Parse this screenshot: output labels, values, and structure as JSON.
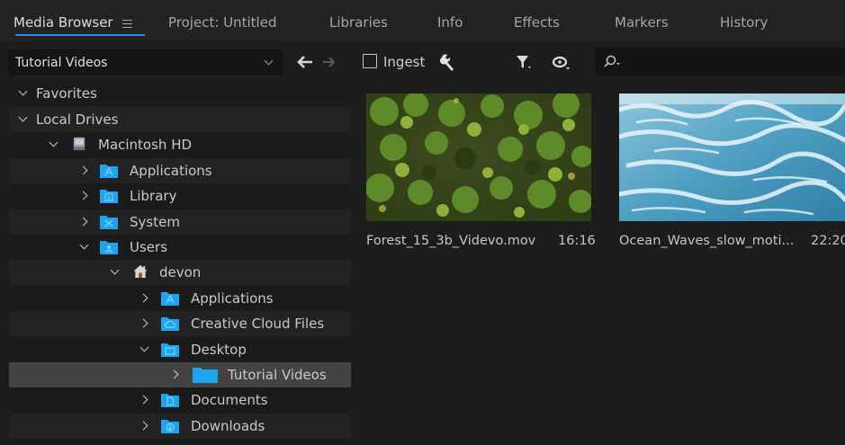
{
  "tabs": [
    {
      "label": "Media Browser",
      "active": true
    },
    {
      "label": "Project: Untitled"
    },
    {
      "label": "Libraries"
    },
    {
      "label": "Info"
    },
    {
      "label": "Effects"
    },
    {
      "label": "Markers"
    },
    {
      "label": "History"
    }
  ],
  "toolbar": {
    "path_value": "Tutorial Videos",
    "ingest_label": "Ingest",
    "ingest_checked": false,
    "search_value": ""
  },
  "tree": [
    {
      "label": "Favorites",
      "expanded": true,
      "icon": "none"
    },
    {
      "label": "Local Drives",
      "expanded": true,
      "icon": "none"
    },
    {
      "label": "Macintosh HD",
      "expanded": true,
      "icon": "hard-drive-icon"
    },
    {
      "label": "Applications",
      "expanded": false,
      "icon": "applications-folder-icon"
    },
    {
      "label": "Library",
      "expanded": false,
      "icon": "library-folder-icon"
    },
    {
      "label": "System",
      "expanded": false,
      "icon": "system-folder-icon"
    },
    {
      "label": "Users",
      "expanded": true,
      "icon": "users-folder-icon"
    },
    {
      "label": "devon",
      "expanded": true,
      "icon": "home-icon"
    },
    {
      "label": "Applications",
      "expanded": false,
      "icon": "applications-folder-icon"
    },
    {
      "label": "Creative Cloud Files",
      "expanded": false,
      "icon": "creative-cloud-folder-icon"
    },
    {
      "label": "Desktop",
      "expanded": true,
      "icon": "desktop-folder-icon"
    },
    {
      "label": "Tutorial Videos",
      "expanded": false,
      "icon": "folder-icon",
      "selected": true
    },
    {
      "label": "Documents",
      "expanded": false,
      "icon": "documents-folder-icon"
    },
    {
      "label": "Downloads",
      "expanded": false,
      "icon": "downloads-folder-icon"
    }
  ],
  "clips": [
    {
      "name": "Forest_15_3b_Videvo.mov",
      "duration": "16:16",
      "thumbnail": "forest"
    },
    {
      "name": "Ocean_Waves_slow_moti...",
      "duration": "22:20",
      "thumbnail": "ocean"
    }
  ],
  "colors": {
    "accent": "#2d8ceb",
    "folder": "#1fa4ee",
    "selected_row": "#434343"
  }
}
